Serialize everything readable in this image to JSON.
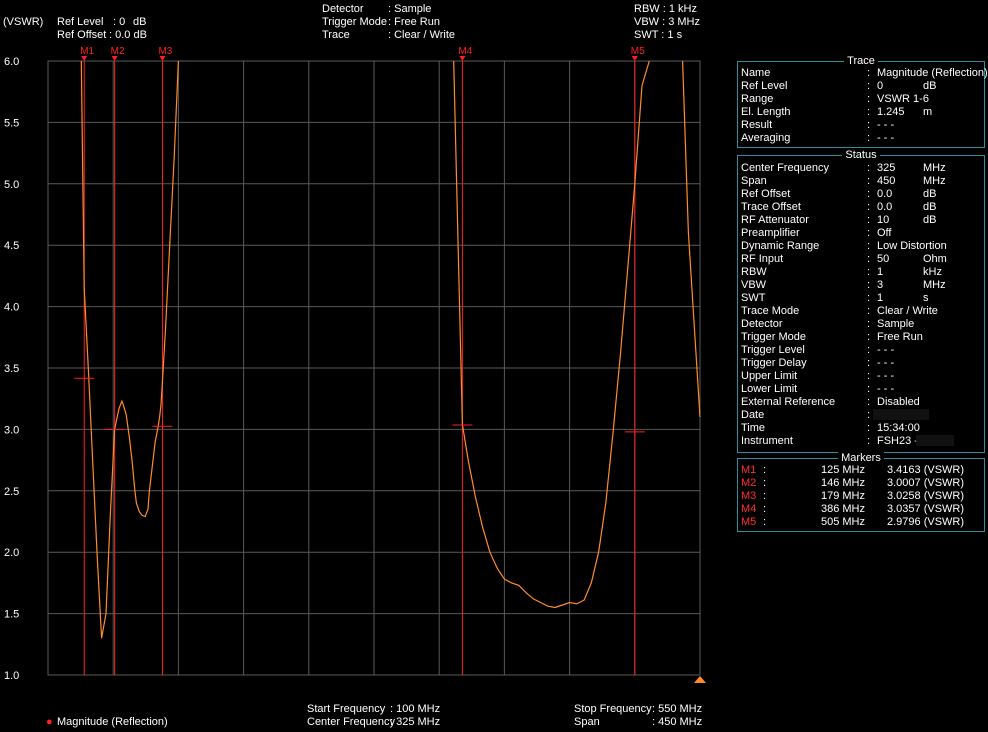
{
  "header": {
    "unit": "(VSWR)",
    "ref_level_label": "Ref Level",
    "ref_level_value": ": 0",
    "ref_level_unit": "dB",
    "ref_offset_label": "Ref Offset",
    "ref_offset_value": ": 0.0 dB",
    "detector_label": "Detector",
    "detector_value": ": Sample",
    "trigger_label": "Trigger Mode",
    "trigger_value": ": Free Run",
    "trace_label": "Trace",
    "trace_value": ": Clear / Write",
    "rbw": "RBW : 1 kHz",
    "vbw": "VBW : 3 MHz",
    "swt": "SWT : 1 s"
  },
  "footer": {
    "legend": "Magnitude (Reflection)",
    "start_label": "Start Frequency",
    "start_value": ": 100 MHz",
    "center_label": "Center Frequency",
    "center_value": ": 325 MHz",
    "stop_label": "Stop Frequency",
    "stop_value": ": 550 MHz",
    "span_label": "Span",
    "span_value": ": 450 MHz"
  },
  "colors": {
    "trace": "#ff8c2a",
    "marker": "#ff2020",
    "grid": "#5a5a5a",
    "panel_border": "#2a8ea0"
  },
  "trace_panel": {
    "title": "Trace",
    "rows": [
      {
        "k": "Name",
        "v": "Magnitude (Reflection)",
        "u": ""
      },
      {
        "k": "Ref Level",
        "v": "  0",
        "u": "dB"
      },
      {
        "k": "Range",
        "v": "VSWR 1-6",
        "u": ""
      },
      {
        "k": "El. Length",
        "v": "  1.245",
        "u": "m"
      },
      {
        "k": "Result",
        "v": "- - -",
        "u": ""
      },
      {
        "k": "Averaging",
        "v": "- - -",
        "u": ""
      }
    ]
  },
  "status_panel": {
    "title": "Status",
    "rows": [
      {
        "k": "Center Frequency",
        "v": "325",
        "u": "MHz"
      },
      {
        "k": "Span",
        "v": "450",
        "u": "MHz"
      },
      {
        "k": "Ref Offset",
        "v": "  0.0",
        "u": "dB"
      },
      {
        "k": "Trace Offset",
        "v": "  0.0",
        "u": "dB"
      },
      {
        "k": "RF Attenuator",
        "v": " 10",
        "u": "dB"
      },
      {
        "k": "Preamplifier",
        "v": "Off",
        "u": ""
      },
      {
        "k": "Dynamic Range",
        "v": "Low Distortion",
        "u": ""
      },
      {
        "k": "RF Input",
        "v": " 50",
        "u": "Ohm"
      },
      {
        "k": "RBW",
        "v": "  1",
        "u": "kHz"
      },
      {
        "k": "VBW",
        "v": "  3",
        "u": "MHz"
      },
      {
        "k": "SWT",
        "v": "  1",
        "u": "s"
      },
      {
        "k": "Trace Mode",
        "v": "Clear / Write",
        "u": ""
      },
      {
        "k": "Detector",
        "v": "Sample",
        "u": ""
      },
      {
        "k": "Trigger Mode",
        "v": "Free Run",
        "u": ""
      },
      {
        "k": "Trigger Level",
        "v": "- - -",
        "u": ""
      },
      {
        "k": "Trigger Delay",
        "v": "- - -",
        "u": ""
      },
      {
        "k": "Upper Limit",
        "v": "- - -",
        "u": ""
      },
      {
        "k": "Lower Limit",
        "v": "- - -",
        "u": ""
      },
      {
        "k": "External Reference",
        "v": "Disabled",
        "u": ""
      },
      {
        "k": "Date",
        "v": "",
        "u": ""
      },
      {
        "k": "Time",
        "v": "15:34:00",
        "u": ""
      },
      {
        "k": "Instrument",
        "v": "FSH23 -",
        "u": ""
      }
    ]
  },
  "markers_panel": {
    "title": "Markers",
    "rows": [
      {
        "n": "M1",
        "f": "125 MHz",
        "v": "3.4163 (VSWR)"
      },
      {
        "n": "M2",
        "f": "146 MHz",
        "v": "3.0007 (VSWR)"
      },
      {
        "n": "M3",
        "f": "179 MHz",
        "v": "3.0258 (VSWR)"
      },
      {
        "n": "M4",
        "f": "386 MHz",
        "v": "3.0357 (VSWR)"
      },
      {
        "n": "M5",
        "f": "505 MHz",
        "v": "2.9796 (VSWR)"
      }
    ]
  },
  "chart_data": {
    "type": "line",
    "xlim": [
      100,
      550
    ],
    "ylim": [
      1.0,
      6.0
    ],
    "yticks": [
      "6.0",
      "5.5",
      "5.0",
      "4.5",
      "4.0",
      "3.5",
      "3.0",
      "2.5",
      "2.0",
      "1.5",
      "1.0"
    ],
    "series": [
      {
        "name": "Magnitude (Reflection)",
        "x": [
          100,
          108,
          115,
          120,
          123,
          125,
          128,
          131,
          134,
          137,
          140,
          143,
          146,
          149,
          151,
          152,
          154,
          156,
          158,
          160,
          161,
          163,
          165,
          167,
          169,
          170,
          172,
          174,
          176,
          177,
          178,
          179,
          181,
          184,
          187,
          190,
          196,
          200,
          205,
          210,
          215,
          230,
          250,
          270,
          290,
          300,
          306,
          310,
          315,
          322,
          330,
          340,
          350,
          370,
          380,
          386,
          390,
          395,
          400,
          405,
          410,
          415,
          420,
          425,
          430,
          435,
          440,
          445,
          450,
          455,
          460,
          465,
          470,
          475,
          480,
          485,
          490,
          495,
          500,
          505,
          510,
          515,
          520,
          525,
          530,
          534,
          538,
          542,
          550
        ],
        "y": [
          null,
          null,
          null,
          null,
          6.0,
          4.15,
          3.45,
          2.7,
          1.95,
          1.3,
          1.5,
          2.3,
          3.0,
          3.17,
          3.23,
          3.2,
          3.12,
          2.95,
          2.75,
          2.5,
          2.4,
          2.33,
          2.3,
          2.29,
          2.35,
          2.5,
          2.7,
          2.9,
          3.02,
          3.1,
          3.2,
          3.4,
          3.8,
          4.5,
          5.2,
          6.0,
          null,
          null,
          null,
          null,
          null,
          null,
          null,
          null,
          null,
          null,
          null,
          null,
          null,
          null,
          null,
          null,
          null,
          null,
          6.0,
          3.04,
          2.75,
          2.45,
          2.2,
          2.0,
          1.87,
          1.78,
          1.75,
          1.73,
          1.67,
          1.62,
          1.59,
          1.56,
          1.55,
          1.57,
          1.59,
          1.58,
          1.61,
          1.75,
          2.0,
          2.4,
          2.98,
          3.6,
          4.3,
          5.0,
          5.8,
          6.0,
          null,
          null,
          null,
          null,
          6.0,
          4.6,
          3.1
        ]
      }
    ],
    "markers": [
      {
        "name": "M1",
        "x": 125,
        "y": 3.4163
      },
      {
        "name": "M2",
        "x": 146,
        "y": 3.0007
      },
      {
        "name": "M3",
        "x": 179,
        "y": 3.0258
      },
      {
        "name": "M4",
        "x": 386,
        "y": 3.0357
      },
      {
        "name": "M5",
        "x": 505,
        "y": 2.9796
      }
    ],
    "grid": true
  }
}
